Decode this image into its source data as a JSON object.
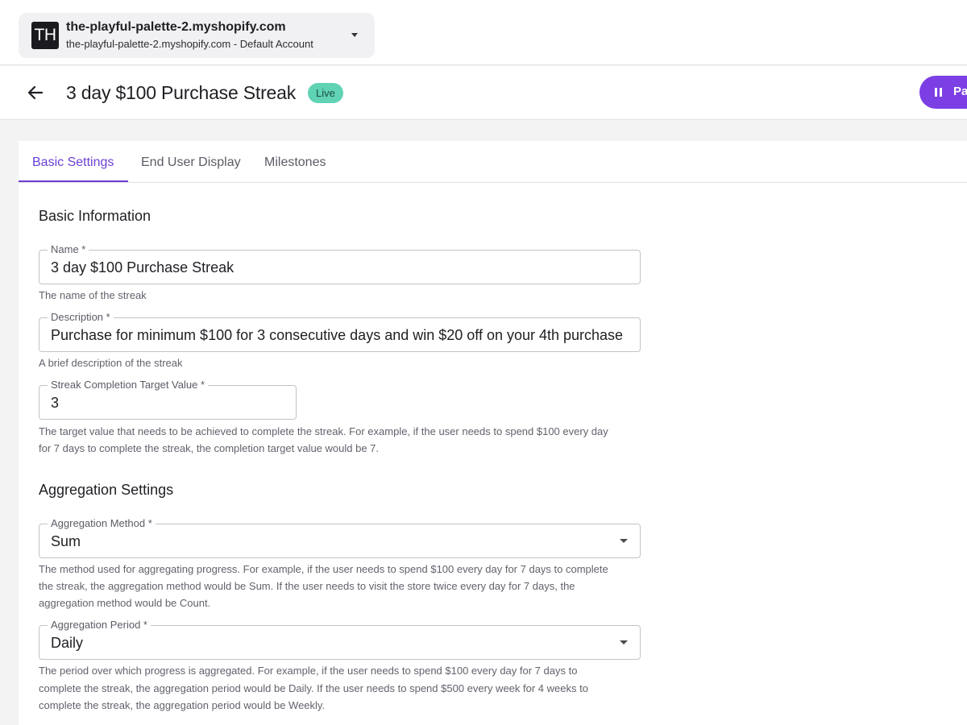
{
  "account": {
    "avatar_initials": "TH",
    "shop_domain": "the-playful-palette-2.myshopify.com",
    "account_label": "the-playful-palette-2.myshopify.com - Default Account"
  },
  "header": {
    "title": "3 day $100 Purchase Streak",
    "status_badge": "Live",
    "pause_button_label": "Pa"
  },
  "tabs": [
    {
      "label": "Basic Settings",
      "active": true
    },
    {
      "label": "End User Display",
      "active": false
    },
    {
      "label": "Milestones",
      "active": false
    }
  ],
  "basic_information": {
    "section_title": "Basic Information",
    "name": {
      "label": "Name *",
      "value": "3 day $100 Purchase Streak",
      "help": "The name of the streak"
    },
    "description": {
      "label": "Description *",
      "value": "Purchase for minimum $100 for 3 consecutive days and win $20 off on your 4th purchase",
      "help": "A brief description of the streak"
    },
    "target_value": {
      "label": "Streak Completion Target Value *",
      "value": "3",
      "help_line1": "The target value that needs to be achieved to complete the streak. For example, if the user needs to spend $100 every day",
      "help_line2": "for 7 days to complete the streak, the completion target value would be 7."
    }
  },
  "aggregation_settings": {
    "section_title": "Aggregation Settings",
    "method": {
      "label": "Aggregation Method *",
      "value": "Sum",
      "help_line1": "The method used for aggregating progress. For example, if the user needs to spend $100 every day for 7 days to complete",
      "help_line2": "the streak, the aggregation method would be Sum. If the user needs to visit the store twice every day for 7 days, the",
      "help_line3": "aggregation method would be Count."
    },
    "period": {
      "label": "Aggregation Period *",
      "value": "Daily",
      "help_line1": "The period over which progress is aggregated. For example, if the user needs to spend $100 every day for 7 days to",
      "help_line2": "complete the streak, the aggregation period would be Daily. If the user needs to spend $500 every week for 4 weeks to",
      "help_line3": "complete the streak, the aggregation period would be Weekly."
    }
  },
  "colors": {
    "accent": "#7b3fe4",
    "tab_active": "#6b3fd4",
    "live_badge": "#5fd3b4"
  }
}
